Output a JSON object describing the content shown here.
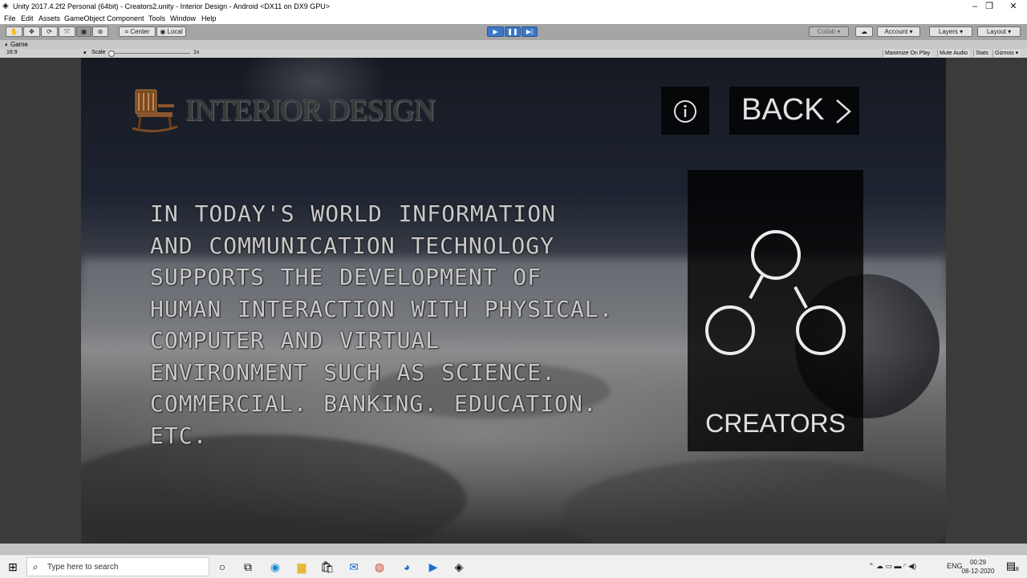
{
  "window": {
    "title": "Unity 2017.4.2f2 Personal (64bit) - Creators2.unity - Interior Design - Android <DX11 on DX9 GPU>",
    "minimize": "–",
    "maximize": "❐",
    "close": "✕"
  },
  "menu": [
    "File",
    "Edit",
    "Assets",
    "GameObject",
    "Component",
    "Tools",
    "Window",
    "Help"
  ],
  "toolbar": {
    "center_label": "Center",
    "local_label": "Local",
    "collab_label": "Collab ▾",
    "account_label": "Account ▾",
    "layers_label": "Layers ▾",
    "layout_label": "Layout ▾"
  },
  "game_view": {
    "tab_label": "Game",
    "aspect": "16:9",
    "scale_label": "Scale",
    "scale_value": "1x",
    "maximize_on_play": "Maximize On Play",
    "mute_audio": "Mute Audio",
    "stats": "Stats",
    "gizmos": "Gizmos ▾"
  },
  "app": {
    "logo_text": "INTERIOR DESIGN",
    "back_label": "BACK",
    "creators_label": "CREATORS",
    "body_lines": [
      "In today's world information",
      "and communication technology",
      "supports the development of",
      "human interaction with physical.",
      "computer and virtual",
      "environment such as science.",
      "commercial. banking. education.",
      "etc."
    ]
  },
  "taskbar": {
    "search_placeholder": "Type here to search",
    "language": "ENG",
    "time": "00:29",
    "date": "08-12-2020",
    "notification_count": "18"
  },
  "colors": {
    "toolbar": "#a5a5a5",
    "play_button": "#3a78c8",
    "panel": "#000000",
    "text": "#e2e2e2"
  }
}
